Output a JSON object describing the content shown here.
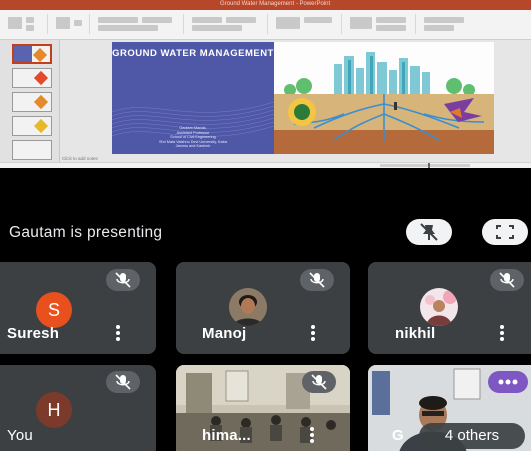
{
  "presentation": {
    "window_title": "Ground Water Management - PowerPoint",
    "slide_title": "GROUND WATER MANAGEMENT",
    "slide_credits": [
      "Gautam Manda,",
      "Assistant Professor",
      "School of Civil Engineering",
      "Shri Mata Vaishno Devi University, Katra",
      "Jammu and Kashmir"
    ],
    "notes_hint": "Click to add notes",
    "accent": "#4f58a7"
  },
  "meet": {
    "presenting_text": "Gautam is presenting",
    "pin_icon": "unpin-icon",
    "fullscreen_icon": "fullscreen-icon",
    "participants": [
      {
        "name": "Suresh",
        "initial": "S",
        "avatar_color": "#e8501e",
        "mic": "mic-off-icon"
      },
      {
        "name": "Manoj",
        "initial": "",
        "mic": "mic-off-icon"
      },
      {
        "name": "nikhil",
        "initial": "",
        "mic": "mic-off-icon"
      },
      {
        "name": "You",
        "initial": "H",
        "avatar_color": "#7b3a2a",
        "mic": "mic-off-icon"
      },
      {
        "name": "hima...",
        "initial": "",
        "mic": "mic-off-icon"
      },
      {
        "name": "G",
        "initial": "",
        "mic": ""
      }
    ],
    "others_label": "4 others"
  }
}
